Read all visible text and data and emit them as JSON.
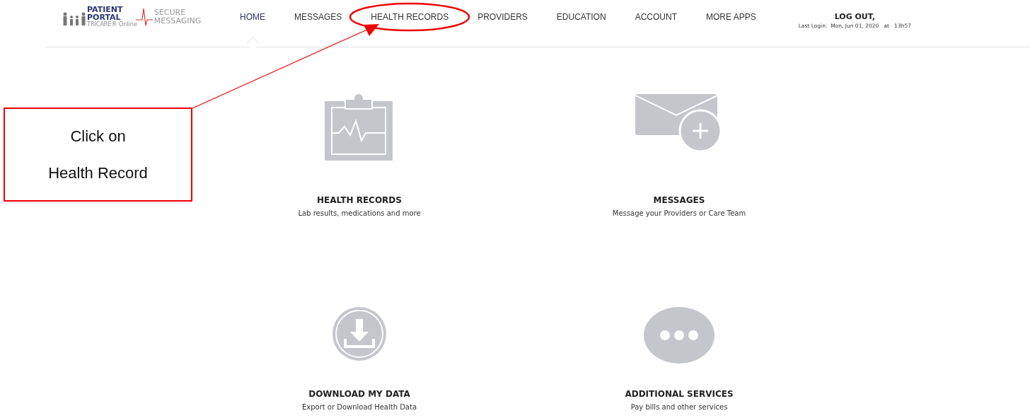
{
  "logo": {
    "brand_line_1": "PATIENT",
    "brand_line_2": "PORTAL",
    "brand_sub": "TRICARE® Online",
    "product_line_1": "SECURE",
    "product_line_2": "MESSAGING"
  },
  "nav": [
    {
      "label": "HOME",
      "selected": true,
      "highlighted": false
    },
    {
      "label": "MESSAGES",
      "selected": false,
      "highlighted": false
    },
    {
      "label": "HEALTH RECORDS",
      "selected": false,
      "highlighted": true
    },
    {
      "label": "PROVIDERS",
      "selected": false,
      "highlighted": false
    },
    {
      "label": "EDUCATION",
      "selected": false,
      "highlighted": false
    },
    {
      "label": "ACCOUNT",
      "selected": false,
      "highlighted": false
    },
    {
      "label": "MORE APPS",
      "selected": false,
      "highlighted": false
    }
  ],
  "logout": {
    "label": "LOG OUT",
    "suffix": ",",
    "last_login": "Last Login:  Mon, Jun 01, 2020   at   13h57"
  },
  "tiles": [
    {
      "kind": "clipboard",
      "title": "HEALTH RECORDS",
      "subtitle": "Lab results, medications and more"
    },
    {
      "kind": "mail",
      "title": "MESSAGES",
      "subtitle": "Message your Providers or Care Team"
    },
    {
      "kind": "download",
      "title": "DOWNLOAD MY DATA",
      "subtitle": "Export or Download Health Data"
    },
    {
      "kind": "more",
      "title": "ADDITIONAL SERVICES",
      "subtitle": "Pay bills and other services"
    }
  ],
  "annotation": {
    "lines": [
      "Click on",
      "Health Record"
    ]
  }
}
